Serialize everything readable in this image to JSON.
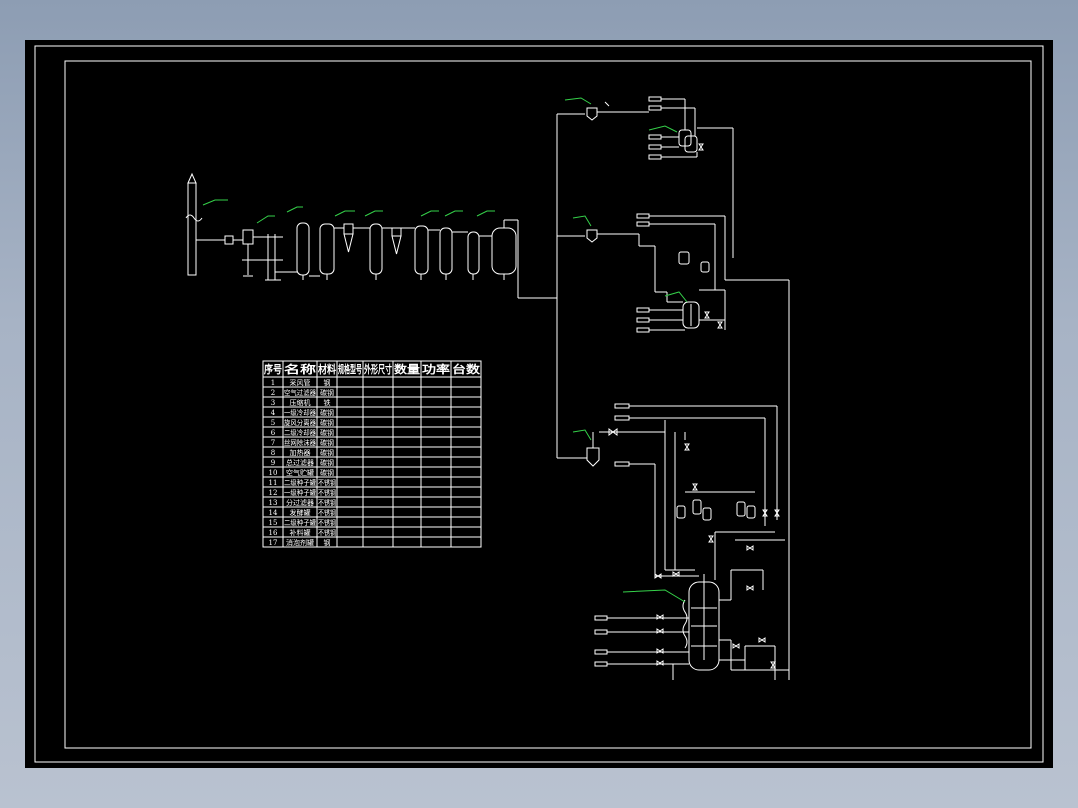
{
  "equipment_table": {
    "headers": [
      "序号",
      "名称",
      "材料",
      "规格型号",
      "外形尺寸",
      "数量",
      "功率",
      "台数"
    ],
    "rows": [
      [
        "1",
        "采风管",
        "钢",
        "",
        "",
        "",
        "",
        ""
      ],
      [
        "2",
        "空气过滤器",
        "碳钢",
        "",
        "",
        "",
        "",
        ""
      ],
      [
        "3",
        "压缩机",
        "铁",
        "",
        "",
        "",
        "",
        ""
      ],
      [
        "4",
        "一级冷却器",
        "碳钢",
        "",
        "",
        "",
        "",
        ""
      ],
      [
        "5",
        "旋风分离器",
        "碳钢",
        "",
        "",
        "",
        "",
        ""
      ],
      [
        "6",
        "二级冷却器",
        "碳钢",
        "",
        "",
        "",
        "",
        ""
      ],
      [
        "7",
        "丝网除沫器",
        "碳钢",
        "",
        "",
        "",
        "",
        ""
      ],
      [
        "8",
        "加热器",
        "碳钢",
        "",
        "",
        "",
        "",
        ""
      ],
      [
        "9",
        "总过滤器",
        "碳钢",
        "",
        "",
        "",
        "",
        ""
      ],
      [
        "10",
        "空气贮罐",
        "碳钢",
        "",
        "",
        "",
        "",
        ""
      ],
      [
        "11",
        "二级种子罐",
        "不锈钢",
        "",
        "",
        "",
        "",
        ""
      ],
      [
        "12",
        "一级种子罐",
        "不锈钢",
        "",
        "",
        "",
        "",
        ""
      ],
      [
        "13",
        "分过滤器",
        "不锈钢",
        "",
        "",
        "",
        "",
        ""
      ],
      [
        "14",
        "发酵罐",
        "不锈钢",
        "",
        "",
        "",
        "",
        ""
      ],
      [
        "15",
        "二级种子罐",
        "不锈钢",
        "",
        "",
        "",
        "",
        ""
      ],
      [
        "16",
        "补料罐",
        "不锈钢",
        "",
        "",
        "",
        "",
        ""
      ],
      [
        "17",
        "消泡剂罐",
        "钢",
        "",
        "",
        "",
        "",
        ""
      ]
    ]
  },
  "colors": {
    "background": "#000000",
    "lines": "#ffffff",
    "leaders": "#35d24a",
    "frame_outer": "#8d9db3"
  }
}
